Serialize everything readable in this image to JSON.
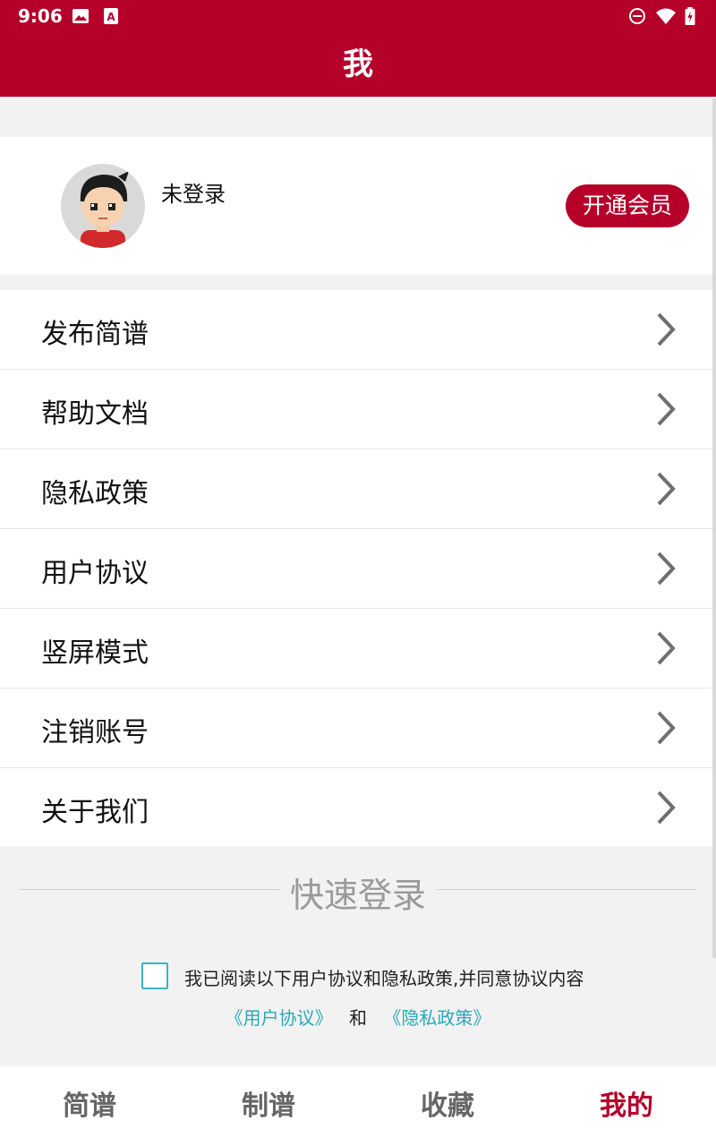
{
  "status_bar": {
    "time": "9:06",
    "icons": [
      "image-icon",
      "font-icon",
      "do-not-disturb-icon",
      "wifi-icon",
      "battery-charging-icon"
    ]
  },
  "header": {
    "title": "我"
  },
  "profile": {
    "username": "未登录",
    "vip_button": "开通会员"
  },
  "menu": {
    "items": [
      {
        "label": "发布简谱"
      },
      {
        "label": "帮助文档"
      },
      {
        "label": "隐私政策"
      },
      {
        "label": "用户协议"
      },
      {
        "label": "竖屏模式"
      },
      {
        "label": "注销账号"
      },
      {
        "label": "关于我们"
      }
    ]
  },
  "quick_login": {
    "title": "快速登录",
    "agreement_text": "我已阅读以下用户协议和隐私政策,并同意协议内容",
    "user_agreement_link": "《用户协议》",
    "and_text": "和",
    "privacy_link": "《隐私政策》",
    "checked": false
  },
  "tabs": [
    {
      "label": "简谱",
      "active": false
    },
    {
      "label": "制谱",
      "active": false
    },
    {
      "label": "收藏",
      "active": false
    },
    {
      "label": "我的",
      "active": true
    }
  ],
  "colors": {
    "brand": "#b5002a",
    "link": "#2aa9b8",
    "background": "#f2f2f2"
  }
}
